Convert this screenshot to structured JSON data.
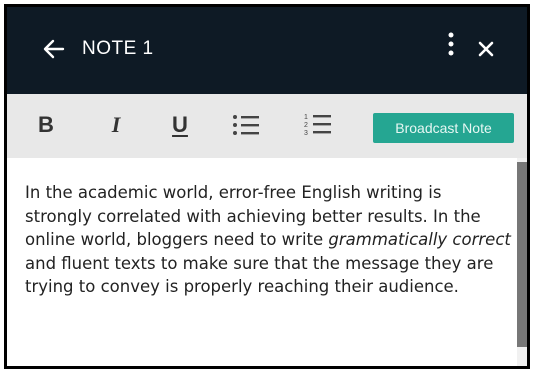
{
  "header": {
    "title": "NOTE 1",
    "icons": [
      "arrow-left-icon",
      "more-vertical-icon",
      "close-icon"
    ]
  },
  "toolbar": {
    "bold": "B",
    "italic": "I",
    "underline": "U",
    "broadcast_label": "Broadcast Note",
    "accent": "#25a692"
  },
  "note": {
    "part1": "In the academic world, error-free English writing is strongly correlated with achieving better results. In the online world, bloggers need to write ",
    "emphasis": "grammatically correct",
    "part2": " and fluent texts to make sure that the message they are trying to convey is properly reaching their audience."
  },
  "colors": {
    "header_bg": "#0e1a25",
    "toolbar_bg": "#e8e8e8"
  }
}
